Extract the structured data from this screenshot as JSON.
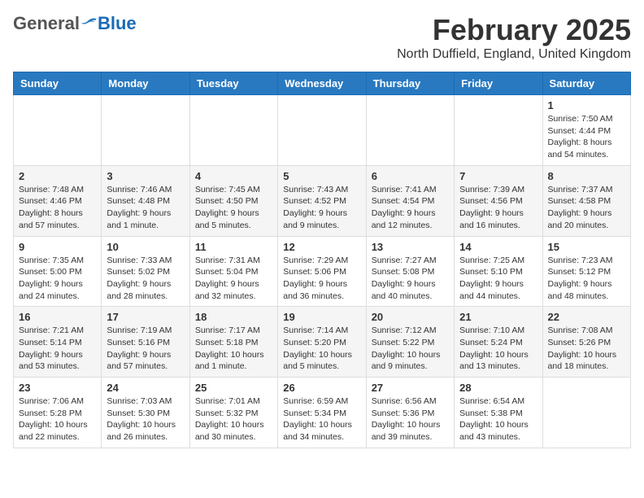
{
  "header": {
    "logo": {
      "general": "General",
      "blue": "Blue"
    },
    "title": "February 2025",
    "location": "North Duffield, England, United Kingdom"
  },
  "weekdays": [
    "Sunday",
    "Monday",
    "Tuesday",
    "Wednesday",
    "Thursday",
    "Friday",
    "Saturday"
  ],
  "weeks": [
    [
      {
        "day": "",
        "info": ""
      },
      {
        "day": "",
        "info": ""
      },
      {
        "day": "",
        "info": ""
      },
      {
        "day": "",
        "info": ""
      },
      {
        "day": "",
        "info": ""
      },
      {
        "day": "",
        "info": ""
      },
      {
        "day": "1",
        "info": "Sunrise: 7:50 AM\nSunset: 4:44 PM\nDaylight: 8 hours and 54 minutes."
      }
    ],
    [
      {
        "day": "2",
        "info": "Sunrise: 7:48 AM\nSunset: 4:46 PM\nDaylight: 8 hours and 57 minutes."
      },
      {
        "day": "3",
        "info": "Sunrise: 7:46 AM\nSunset: 4:48 PM\nDaylight: 9 hours and 1 minute."
      },
      {
        "day": "4",
        "info": "Sunrise: 7:45 AM\nSunset: 4:50 PM\nDaylight: 9 hours and 5 minutes."
      },
      {
        "day": "5",
        "info": "Sunrise: 7:43 AM\nSunset: 4:52 PM\nDaylight: 9 hours and 9 minutes."
      },
      {
        "day": "6",
        "info": "Sunrise: 7:41 AM\nSunset: 4:54 PM\nDaylight: 9 hours and 12 minutes."
      },
      {
        "day": "7",
        "info": "Sunrise: 7:39 AM\nSunset: 4:56 PM\nDaylight: 9 hours and 16 minutes."
      },
      {
        "day": "8",
        "info": "Sunrise: 7:37 AM\nSunset: 4:58 PM\nDaylight: 9 hours and 20 minutes."
      }
    ],
    [
      {
        "day": "9",
        "info": "Sunrise: 7:35 AM\nSunset: 5:00 PM\nDaylight: 9 hours and 24 minutes."
      },
      {
        "day": "10",
        "info": "Sunrise: 7:33 AM\nSunset: 5:02 PM\nDaylight: 9 hours and 28 minutes."
      },
      {
        "day": "11",
        "info": "Sunrise: 7:31 AM\nSunset: 5:04 PM\nDaylight: 9 hours and 32 minutes."
      },
      {
        "day": "12",
        "info": "Sunrise: 7:29 AM\nSunset: 5:06 PM\nDaylight: 9 hours and 36 minutes."
      },
      {
        "day": "13",
        "info": "Sunrise: 7:27 AM\nSunset: 5:08 PM\nDaylight: 9 hours and 40 minutes."
      },
      {
        "day": "14",
        "info": "Sunrise: 7:25 AM\nSunset: 5:10 PM\nDaylight: 9 hours and 44 minutes."
      },
      {
        "day": "15",
        "info": "Sunrise: 7:23 AM\nSunset: 5:12 PM\nDaylight: 9 hours and 48 minutes."
      }
    ],
    [
      {
        "day": "16",
        "info": "Sunrise: 7:21 AM\nSunset: 5:14 PM\nDaylight: 9 hours and 53 minutes."
      },
      {
        "day": "17",
        "info": "Sunrise: 7:19 AM\nSunset: 5:16 PM\nDaylight: 9 hours and 57 minutes."
      },
      {
        "day": "18",
        "info": "Sunrise: 7:17 AM\nSunset: 5:18 PM\nDaylight: 10 hours and 1 minute."
      },
      {
        "day": "19",
        "info": "Sunrise: 7:14 AM\nSunset: 5:20 PM\nDaylight: 10 hours and 5 minutes."
      },
      {
        "day": "20",
        "info": "Sunrise: 7:12 AM\nSunset: 5:22 PM\nDaylight: 10 hours and 9 minutes."
      },
      {
        "day": "21",
        "info": "Sunrise: 7:10 AM\nSunset: 5:24 PM\nDaylight: 10 hours and 13 minutes."
      },
      {
        "day": "22",
        "info": "Sunrise: 7:08 AM\nSunset: 5:26 PM\nDaylight: 10 hours and 18 minutes."
      }
    ],
    [
      {
        "day": "23",
        "info": "Sunrise: 7:06 AM\nSunset: 5:28 PM\nDaylight: 10 hours and 22 minutes."
      },
      {
        "day": "24",
        "info": "Sunrise: 7:03 AM\nSunset: 5:30 PM\nDaylight: 10 hours and 26 minutes."
      },
      {
        "day": "25",
        "info": "Sunrise: 7:01 AM\nSunset: 5:32 PM\nDaylight: 10 hours and 30 minutes."
      },
      {
        "day": "26",
        "info": "Sunrise: 6:59 AM\nSunset: 5:34 PM\nDaylight: 10 hours and 34 minutes."
      },
      {
        "day": "27",
        "info": "Sunrise: 6:56 AM\nSunset: 5:36 PM\nDaylight: 10 hours and 39 minutes."
      },
      {
        "day": "28",
        "info": "Sunrise: 6:54 AM\nSunset: 5:38 PM\nDaylight: 10 hours and 43 minutes."
      },
      {
        "day": "",
        "info": ""
      }
    ]
  ]
}
